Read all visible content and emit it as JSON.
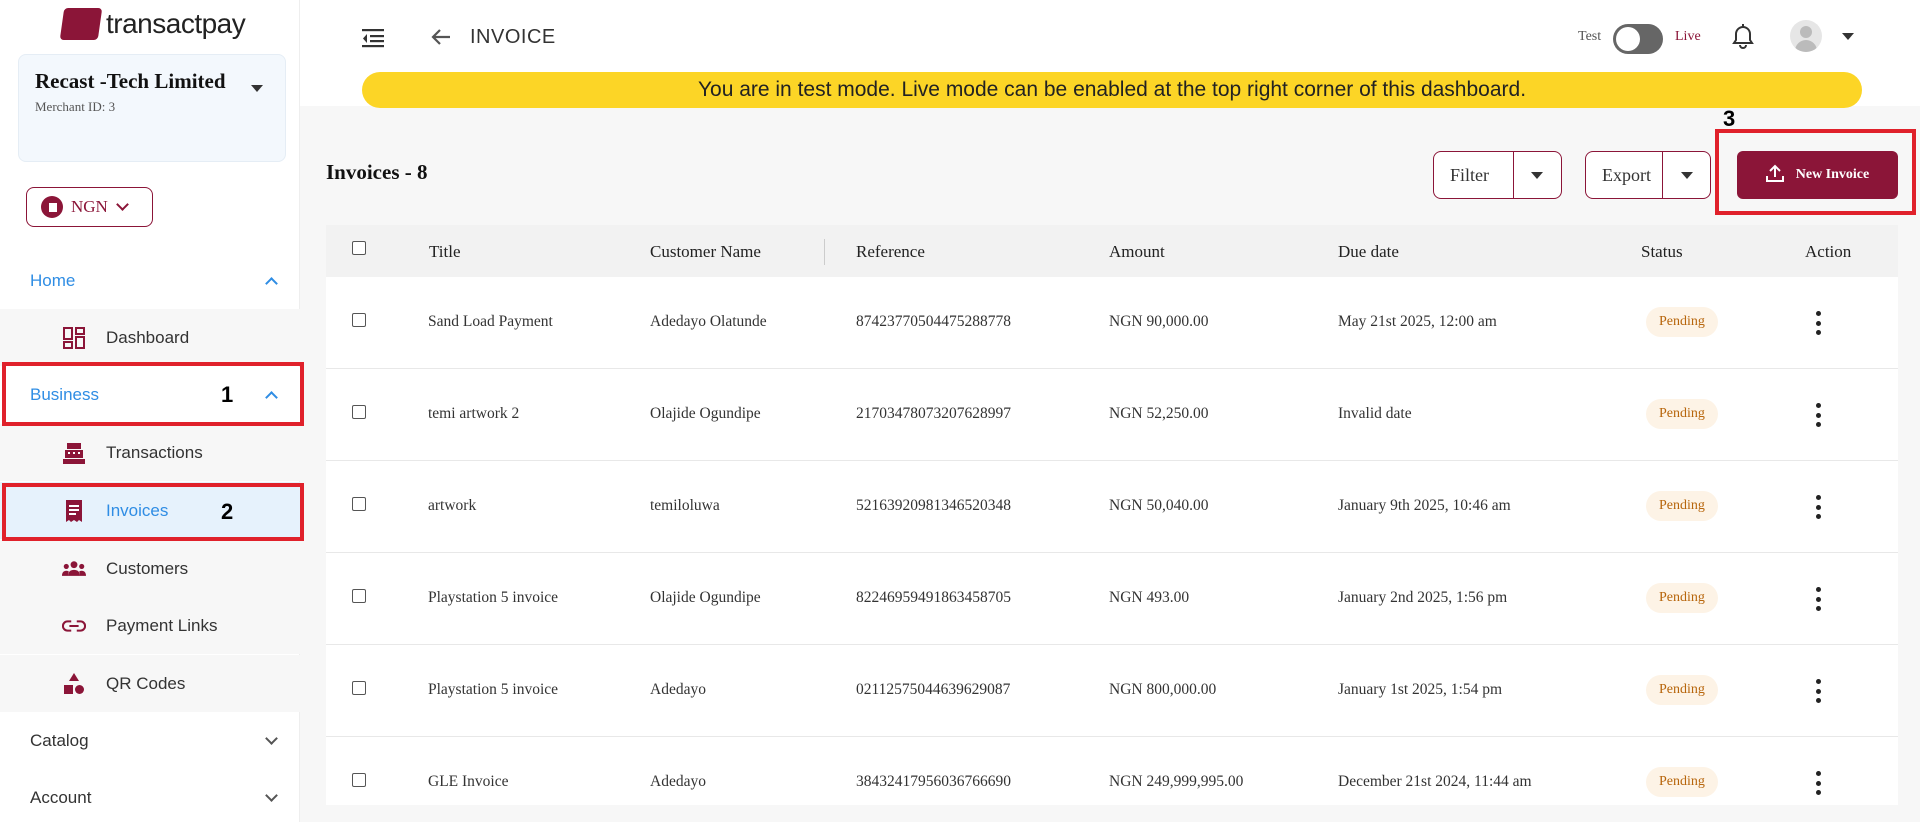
{
  "brand": {
    "name": "transactpay"
  },
  "merchant": {
    "name": "Recast -Tech Limited",
    "id_label": "Merchant ID: 3"
  },
  "currency": {
    "code": "NGN"
  },
  "nav": {
    "home": "Home",
    "dashboard": "Dashboard",
    "business": "Business",
    "transactions": "Transactions",
    "invoices": "Invoices",
    "customers": "Customers",
    "payment_links": "Payment Links",
    "qr_codes": "QR Codes",
    "catalog": "Catalog",
    "account": "Account"
  },
  "annotations": {
    "one": "1",
    "two": "2",
    "three": "3"
  },
  "header": {
    "title": "INVOICE",
    "test_label": "Test",
    "live_label": "Live",
    "banner": "You are in test mode. Live mode can be enabled at the top right corner of this dashboard."
  },
  "toolbar": {
    "count_label": "Invoices - 8",
    "filter": "Filter",
    "export": "Export",
    "new_invoice": "New Invoice"
  },
  "table": {
    "columns": [
      "Title",
      "Customer Name",
      "Reference",
      "Amount",
      "Due date",
      "Status",
      "Action"
    ],
    "rows": [
      {
        "title": "Sand Load Payment",
        "customer": "Adedayo Olatunde",
        "reference": "87423770504475288778",
        "amount": "NGN 90,000.00",
        "due": "May 21st 2025, 12:00 am",
        "status": "Pending"
      },
      {
        "title": "temi artwork 2",
        "customer": "Olajide Ogundipe",
        "reference": "21703478073207628997",
        "amount": "NGN 52,250.00",
        "due": "Invalid date",
        "status": "Pending"
      },
      {
        "title": "artwork",
        "customer": "temiloluwa",
        "reference": "52163920981346520348",
        "amount": "NGN 50,040.00",
        "due": "January 9th 2025, 10:46 am",
        "status": "Pending"
      },
      {
        "title": "Playstation 5 invoice",
        "customer": "Olajide Ogundipe",
        "reference": "82246959491863458705",
        "amount": "NGN 493.00",
        "due": "January 2nd 2025, 1:56 pm",
        "status": "Pending"
      },
      {
        "title": "Playstation 5 invoice",
        "customer": "Adedayo",
        "reference": "02112575044639629087",
        "amount": "NGN 800,000.00",
        "due": "January 1st 2025, 1:54 pm",
        "status": "Pending"
      },
      {
        "title": "GLE Invoice",
        "customer": "Adedayo",
        "reference": "38432417956036766690",
        "amount": "NGN 249,999,995.00",
        "due": "December 21st 2024, 11:44 am",
        "status": "Pending"
      }
    ]
  },
  "colors": {
    "brand": "#8b1538",
    "accent_blue": "#2f8de4",
    "banner": "#fcd526",
    "annotation": "#e0212b"
  }
}
